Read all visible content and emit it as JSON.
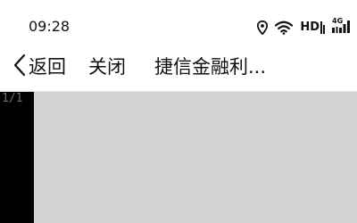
{
  "status_bar": {
    "time": "09:28",
    "icons": [
      "location-icon",
      "wifi-icon",
      "hd-icon",
      "network-4g-icon",
      "signal-icon"
    ],
    "hd_label": "HD",
    "network_label": "4G"
  },
  "nav": {
    "back_label": "返回",
    "close_label": "关闭",
    "title": "捷信金融利..."
  },
  "viewer": {
    "page_counter": "1/1"
  },
  "colors": {
    "background": "#ffffff",
    "viewer_background": "#d2d2d2",
    "side_panel": "#000000",
    "page_counter_text": "#6e6e6e"
  }
}
